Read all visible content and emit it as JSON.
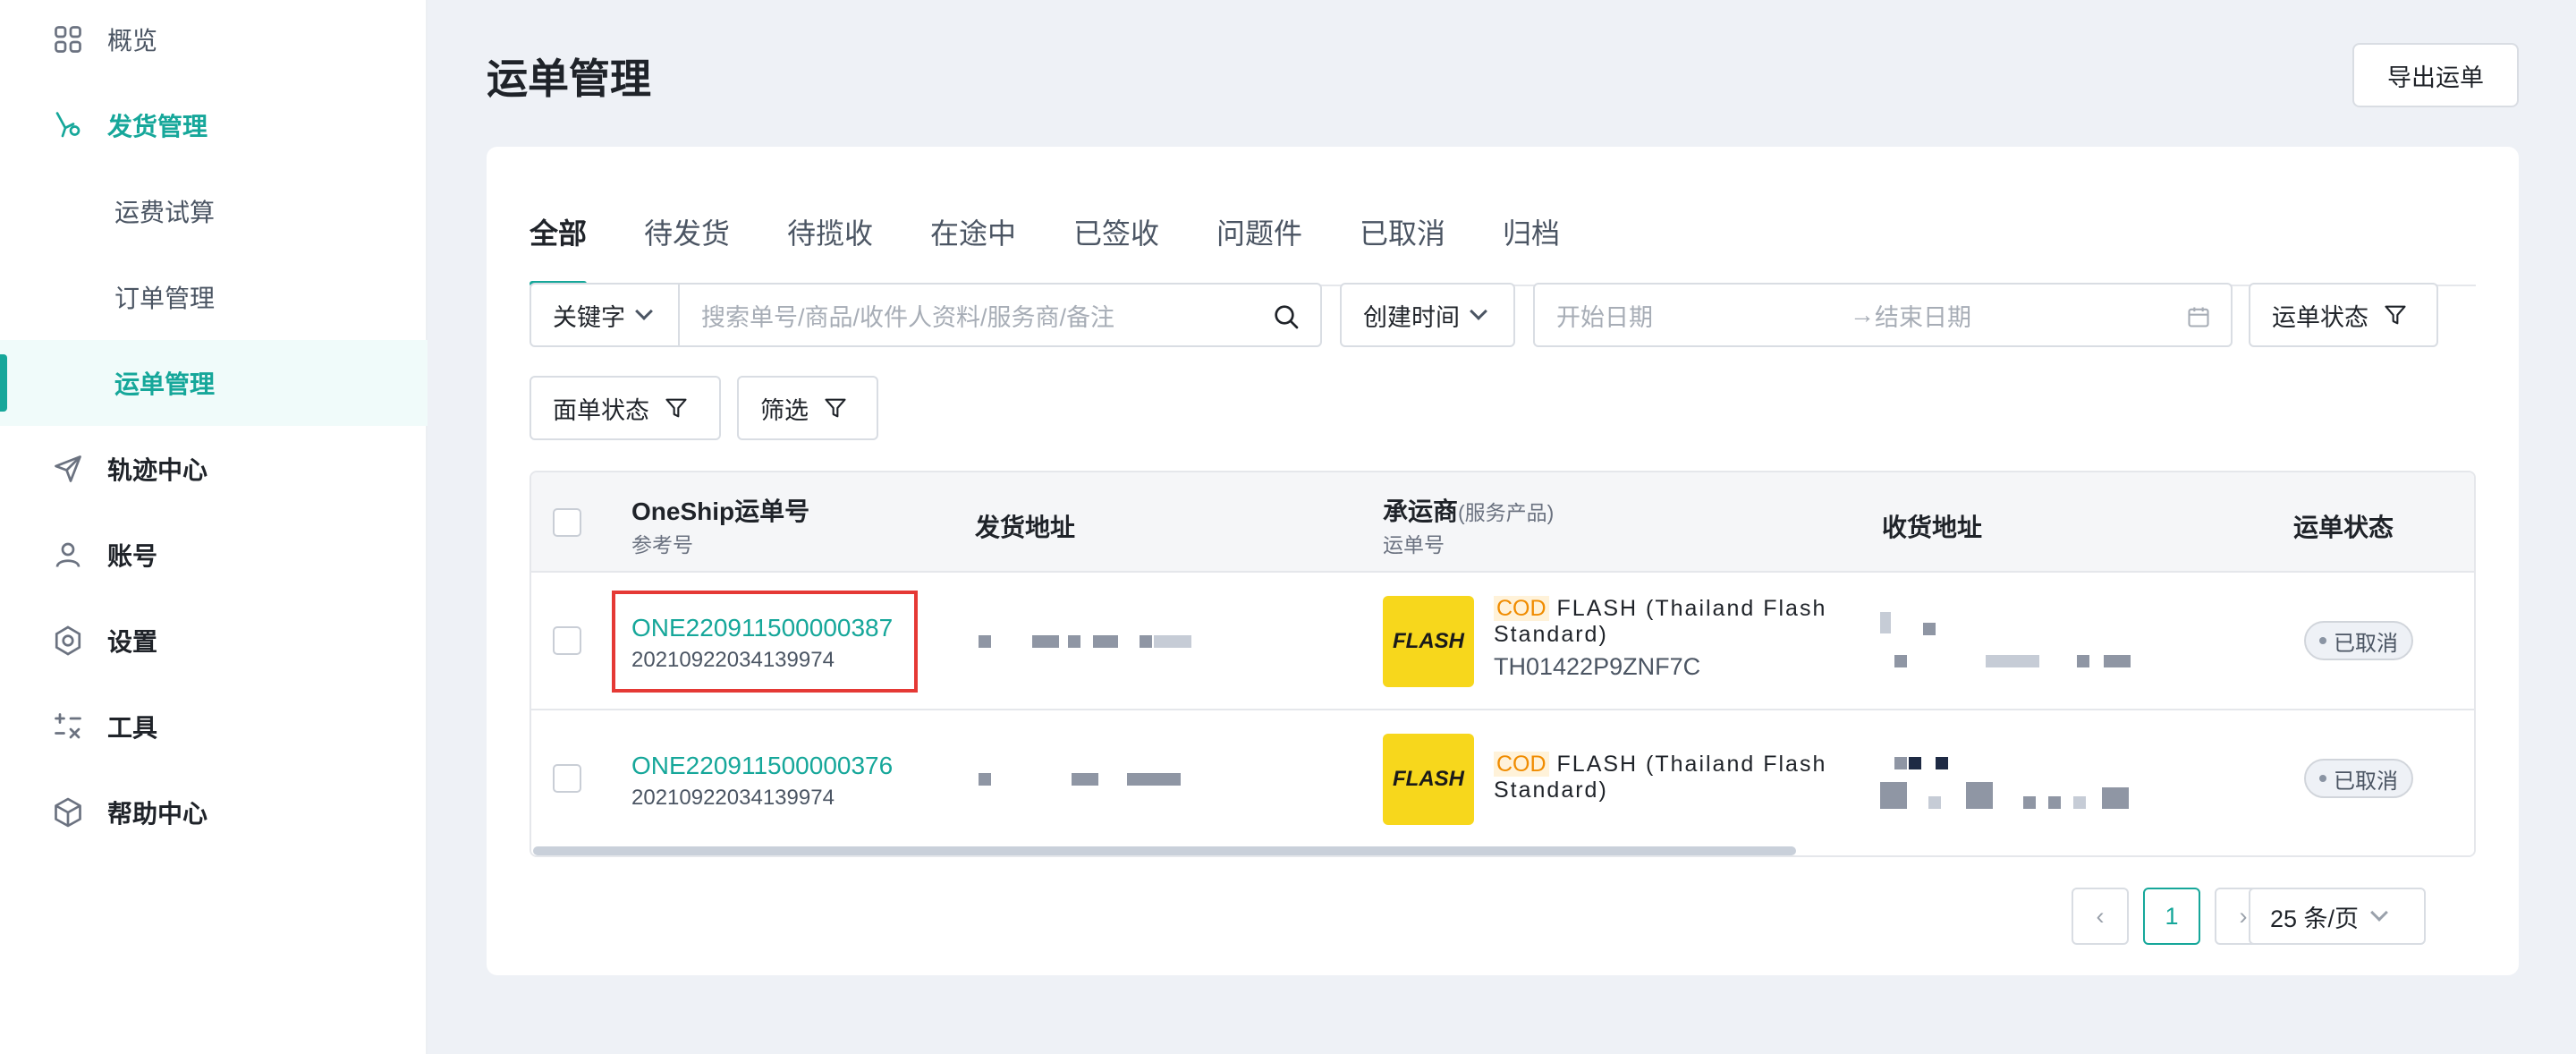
{
  "colors": {
    "accent": "#16a79a",
    "highlight": "#e53935",
    "cod": "#f08c00",
    "flash_yellow": "#f7d71c"
  },
  "sidebar": {
    "items": [
      {
        "label": "概览",
        "icon": "grid-icon"
      },
      {
        "label": "发货管理",
        "icon": "shipping-hand-icon"
      },
      {
        "label": "运费试算"
      },
      {
        "label": "订单管理"
      },
      {
        "label": "运单管理"
      },
      {
        "label": "轨迹中心",
        "icon": "send-icon"
      },
      {
        "label": "账号",
        "icon": "user-icon"
      },
      {
        "label": "设置",
        "icon": "settings-icon"
      },
      {
        "label": "工具",
        "icon": "calculator-icon"
      },
      {
        "label": "帮助中心",
        "icon": "box-icon"
      }
    ]
  },
  "header": {
    "title": "运单管理",
    "export_label": "导出运单"
  },
  "tabs": [
    "全部",
    "待发货",
    "待揽收",
    "在途中",
    "已签收",
    "问题件",
    "已取消",
    "归档"
  ],
  "filters": {
    "keyword_select": "关键字",
    "search_placeholder": "搜索单号/商品/收件人资料/服务商/备注",
    "time_select": "创建时间",
    "start_placeholder": "开始日期",
    "end_placeholder": "结束日期",
    "shipment_status": "运单状态",
    "label_status": "面单状态",
    "filter": "筛选"
  },
  "table": {
    "headers": {
      "oneship": "OneShip运单号",
      "ref": "参考号",
      "from": "发货地址",
      "carrier": "承运商",
      "carrier_sub": "(服务产品)",
      "tracking": "运单号",
      "to": "收货地址",
      "status": "运单状态"
    },
    "rows": [
      {
        "oneship_no": "ONE220911500000387",
        "ref_no": "20210922034139974",
        "logo_text": "FLASH",
        "cod": "COD",
        "carrier": "FLASH (Thailand Flash Standard)",
        "tracking_no": "TH01422P9ZNF7C",
        "status": "已取消"
      },
      {
        "oneship_no": "ONE220911500000376",
        "ref_no": "20210922034139974",
        "logo_text": "FLASH",
        "cod": "COD",
        "carrier": "FLASH (Thailand Flash Standard)",
        "tracking_no": "",
        "status": "已取消"
      }
    ]
  },
  "pagination": {
    "current": "1",
    "page_size": "25 条/页"
  }
}
